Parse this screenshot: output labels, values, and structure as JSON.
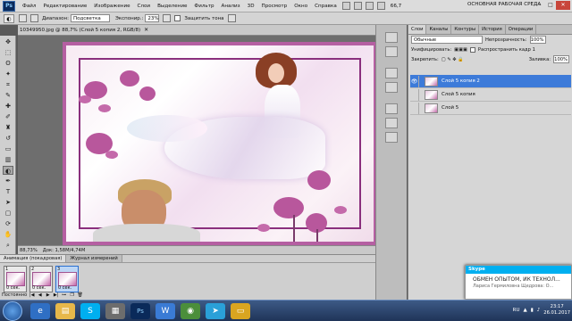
{
  "menu": {
    "logo": "Ps",
    "items": [
      "Файл",
      "Редактирование",
      "Изображение",
      "Слои",
      "Выделение",
      "Фильтр",
      "Анализ",
      "3D",
      "Просмотр",
      "Окно",
      "Справка"
    ],
    "zoom": "66,7",
    "workspace": "ОСНОВНАЯ РАБОЧАЯ СРЕДА"
  },
  "options": {
    "range_label": "Диапазон:",
    "range_value": "Подсветка",
    "exposure_label": "Экспонир.:",
    "exposure_value": "23%",
    "protect_label": "Защитить тона"
  },
  "document": {
    "tab_title": "10349950.jpg @ 88,7% (Слой 5 копия 2, RGB/8)",
    "status_zoom": "88,73%",
    "status_doc": "Док: 1,58M/4,74M"
  },
  "animation": {
    "tabs": [
      "Анимация (покадровая)",
      "Журнал измерений"
    ],
    "frames": [
      {
        "num": "1",
        "time": "0 сек."
      },
      {
        "num": "2",
        "time": "0 сек."
      },
      {
        "num": "3",
        "time": "0 сек."
      }
    ],
    "loop": "Постоянно"
  },
  "layers_panel": {
    "tabs": [
      "Слои",
      "Каналы",
      "Контуры",
      "История",
      "Операции"
    ],
    "blend_mode": "Обычные",
    "opacity_label": "Непрозрачность:",
    "opacity_value": "100%",
    "unify_label": "Унифицировать:",
    "propagate_label": "Распространить кадр 1",
    "lock_label": "Закрепить:",
    "fill_label": "Заливка:",
    "fill_value": "100%",
    "layers": [
      {
        "name": "Слой 5 копия 2",
        "visible": true,
        "active": true
      },
      {
        "name": "Слой 5 копия",
        "visible": false,
        "active": false
      },
      {
        "name": "Слой 5",
        "visible": false,
        "active": false
      }
    ]
  },
  "skype": {
    "header": "Skype",
    "title": "ОБМЕН ОПЫТОМ, ИК ТЕХНОЛ...",
    "message": "Лариса Гермиловна Щедрова: О..."
  },
  "taskbar": {
    "lang": "RU",
    "time": "23:17",
    "date": "26.01.2017"
  },
  "colors": {
    "accent": "#3d7bd9",
    "frame_border": "#8a2f7d",
    "flower": "#b8579c",
    "skype": "#00aff0"
  }
}
